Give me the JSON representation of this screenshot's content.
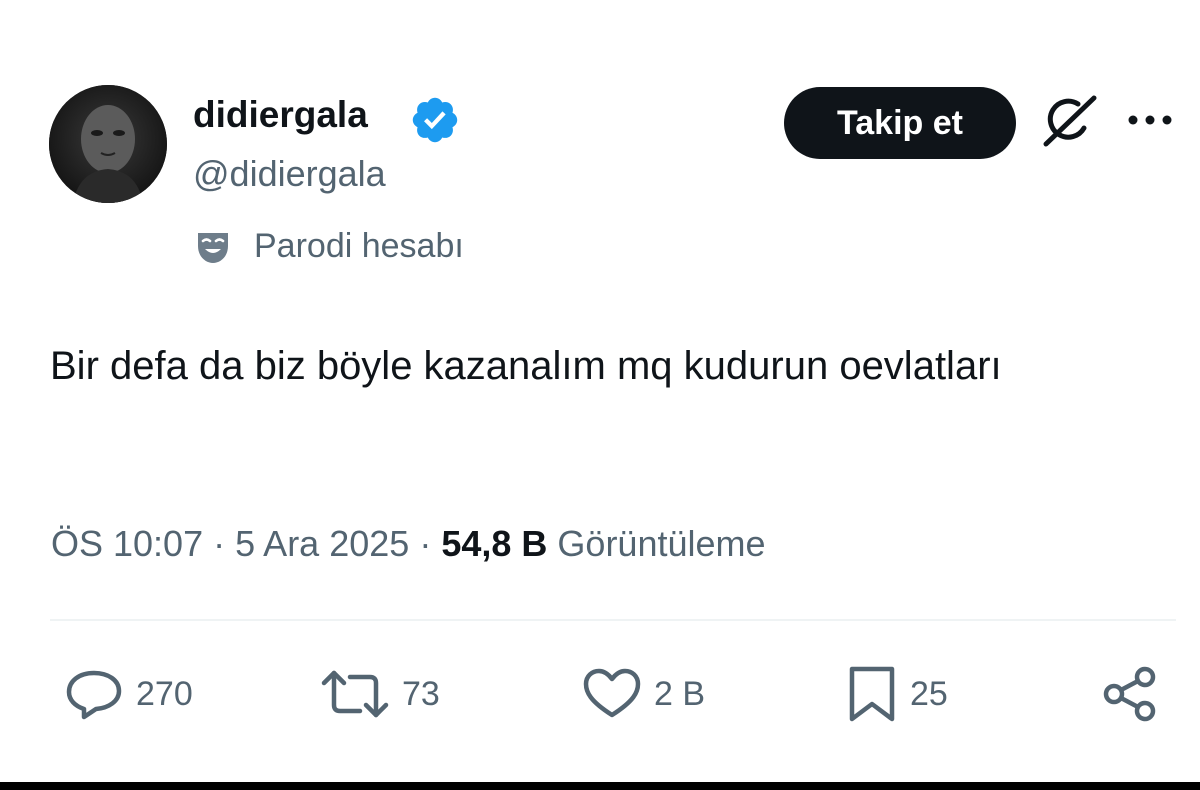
{
  "tweet": {
    "author": {
      "display_name": "didiergala",
      "handle": "@didiergala",
      "verified": true,
      "label": "Parodi hesabı"
    },
    "follow_button": "Takip et",
    "text": "Bir defa da biz böyle kazanalım mq kudurun oevlatları",
    "time": "ÖS 10:07",
    "date": "5 Ara 2025",
    "separator": "·",
    "views": {
      "count": "54,8 B",
      "label": "Görüntüleme"
    },
    "actions": {
      "replies": "270",
      "reposts": "73",
      "likes": "2 B",
      "bookmarks": "25"
    }
  },
  "icons": {
    "verified": "verified-badge-icon",
    "parody": "parody-mask-icon",
    "grok": "grok-icon",
    "more": "more-icon",
    "reply": "reply-icon",
    "repost": "repost-icon",
    "like": "heart-icon",
    "bookmark": "bookmark-icon",
    "share": "share-icon"
  },
  "colors": {
    "text_primary": "#0f1419",
    "text_secondary": "#536471",
    "verified_blue": "#1d9bf0",
    "button_bg": "#0f1419",
    "divider": "#eff3f4"
  }
}
